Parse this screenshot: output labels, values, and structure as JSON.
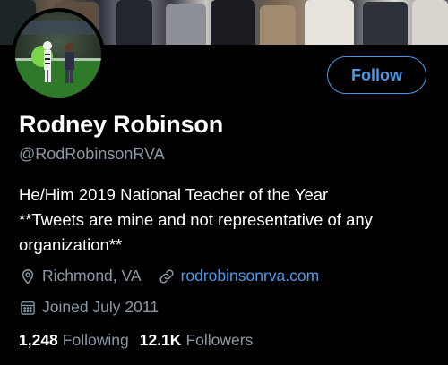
{
  "profile": {
    "name": "Rodney Robinson",
    "handle": "@RodRobinsonRVA",
    "bio_lines": [
      "He/Him 2019 National Teacher of the Year",
      "**Tweets are mine and not representative of any",
      "organization**"
    ],
    "location": "Richmond, VA",
    "website": "rodrobinsonrva.com",
    "joined": "Joined July 2011"
  },
  "actions": {
    "follow_label": "Follow"
  },
  "stats": {
    "following_count": "1,248",
    "following_label": "Following",
    "followers_count": "12.1K",
    "followers_label": "Followers"
  },
  "colors": {
    "background": "#000000",
    "accent": "#4a99e9",
    "secondary_text": "#8899a6"
  },
  "icons": {
    "location": "map-pin-icon",
    "website": "link-icon",
    "joined": "calendar-icon"
  }
}
